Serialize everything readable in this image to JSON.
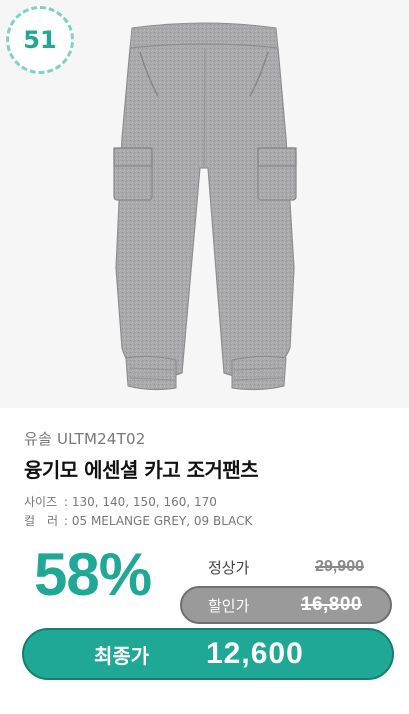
{
  "rank": "51",
  "product": {
    "brand_line": "유솔 ULTM24T02",
    "title": "융기모 에센셜 카고 조거팬츠",
    "size_label": "사이즈",
    "sizes": ": 130, 140, 150, 160, 170",
    "color_label": "컬　러",
    "colors": ": 05 MELANGE GREY, 09 BLACK",
    "image_icon": "grey-cargo-jogger-pants"
  },
  "pricing": {
    "discount": "58%",
    "regular_label": "정상가",
    "regular_price": "29,900",
    "sale_label": "할인가",
    "sale_price": "16,800",
    "final_label": "최종가",
    "final_price": "12,600"
  },
  "colors": {
    "accent": "#1fa895",
    "badge_border": "#7fd1c4",
    "sale_pill": "#9a9a9a"
  }
}
